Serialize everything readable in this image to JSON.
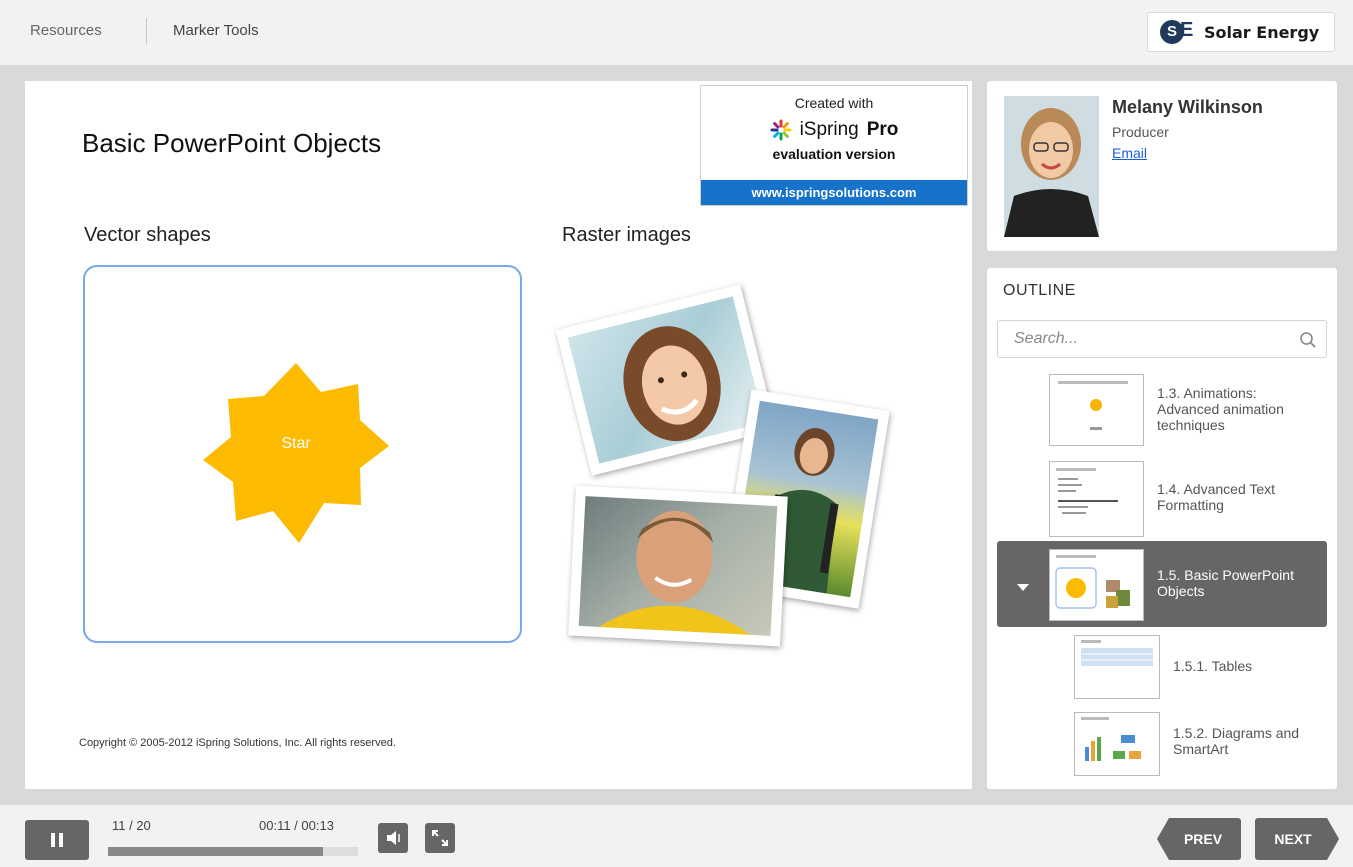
{
  "topbar": {
    "resources_label": "Resources",
    "marker_tools_label": "Marker Tools",
    "logo_text": "Solar Energy",
    "logo_mark_s": "S",
    "logo_mark_e": "E"
  },
  "slide": {
    "title": "Basic PowerPoint Objects",
    "vector_label": "Vector shapes",
    "raster_label": "Raster images",
    "star_label": "Star",
    "copyright": "Copyright © 2005-2012 iSpring Solutions, Inc. All rights reserved.",
    "star_color": "#fdbb00",
    "vector_border_color": "#7aa7e6",
    "watermark": {
      "created": "Created with",
      "brand_a": "iSpring ",
      "brand_b": "Pro",
      "evaluation": "evaluation version",
      "url": "www.ispringsolutions.com"
    }
  },
  "presenter": {
    "name": "Melany Wilkinson",
    "role": "Producer",
    "email_label": "Email"
  },
  "outline": {
    "title": "OUTLINE",
    "search_placeholder": "Search...",
    "items": [
      {
        "label": "1.3. Animations: Advanced animation techniques",
        "active": false
      },
      {
        "label": "1.4. Advanced Text Formatting",
        "active": false
      },
      {
        "label": "1.5. Basic PowerPoint Objects",
        "active": true
      },
      {
        "label": "1.5.1. Tables",
        "active": false
      },
      {
        "label": "1.5.2. Diagrams and SmartArt",
        "active": false
      }
    ]
  },
  "player": {
    "counter": "11 / 20",
    "time": "00:11 / 00:13",
    "progress": 0.86,
    "prev_label": "PREV",
    "next_label": "NEXT",
    "accent_color": "#666666"
  }
}
